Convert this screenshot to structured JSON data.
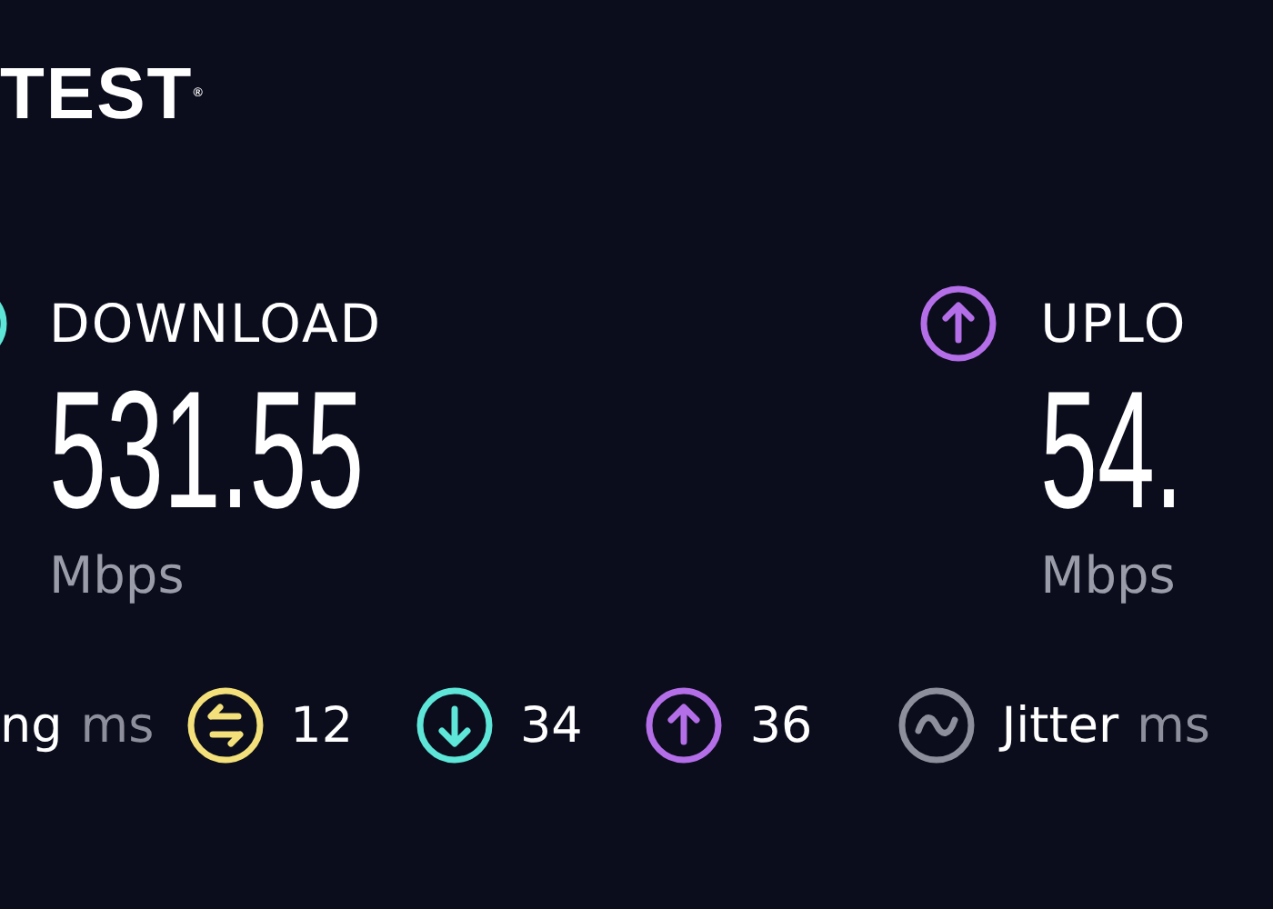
{
  "logo": {
    "text": "TEST$^{®}$"
  },
  "results": [
    {
      "kind": "download",
      "label": "DOWNLOAD",
      "value": "531.55",
      "unit": "Mbps",
      "color": "#5ee6d8"
    },
    {
      "kind": "upload",
      "label": "UPLO",
      "value": "54.",
      "unit": "Mbps",
      "color": "#b46ee8"
    }
  ],
  "latency": {
    "label": "ng",
    "unit": "ms",
    "items": [
      {
        "kind": "idle",
        "value": "12",
        "color": "#f3e07a"
      },
      {
        "kind": "download",
        "value": "34",
        "color": "#5ee6d8"
      },
      {
        "kind": "upload",
        "value": "36",
        "color": "#b46ee8"
      }
    ]
  },
  "jitter": {
    "label": "Jitter",
    "unit": "ms"
  }
}
